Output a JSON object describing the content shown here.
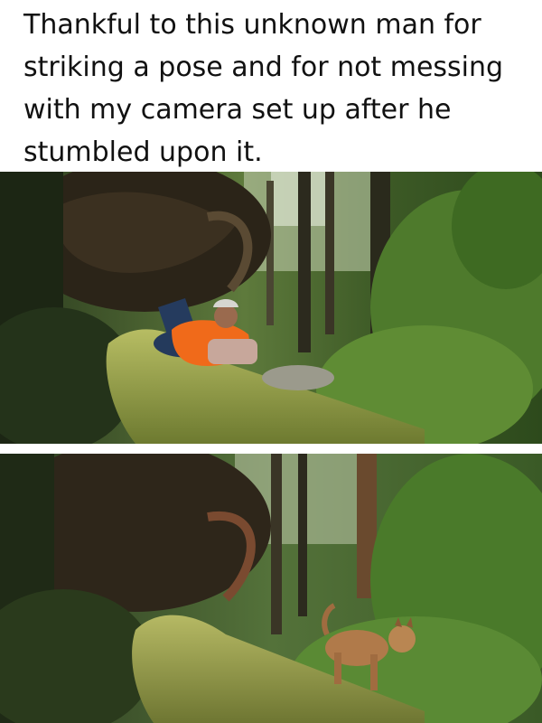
{
  "post": {
    "caption": "Thankful to this unknown man for striking a pose and for not messing with my camera set up after he stumbled upon it."
  },
  "photos": [
    {
      "subject": "man lying on mossy fallen log in forest, wearing orange safety vest and cap"
    },
    {
      "subject": "bobcat walking on the same mossy fallen log"
    }
  ],
  "colors": {
    "forest_dark": "#1f2b17",
    "forest_mid": "#3f5a2a",
    "foliage_light": "#7fa24a",
    "moss": "#a9b25a",
    "vest_orange": "#f06a1a",
    "bobcat_tan": "#b07a4a",
    "sky_gap": "#dfe6d6"
  }
}
